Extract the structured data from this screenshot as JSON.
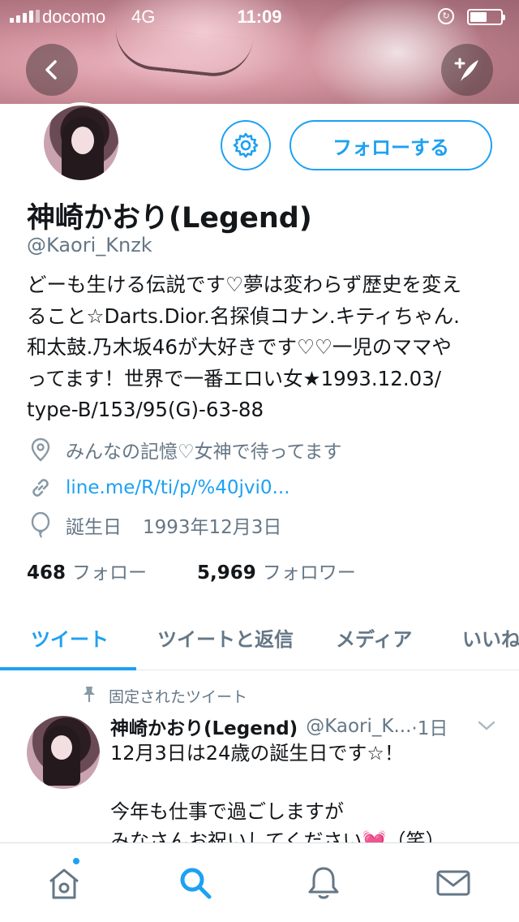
{
  "status_bar": {
    "carrier": "docomo",
    "network": "4G",
    "time": "11:09",
    "battery_level": 0.55
  },
  "header": {
    "back_icon": "chevron-left-icon",
    "compose_icon": "quill-plus-icon"
  },
  "profile": {
    "display_name": "神崎かおり(Legend)",
    "handle": "@Kaori_Knzk",
    "follow_label": "フォローする",
    "settings_icon": "gear-icon",
    "bio_lines": [
      "どーも生ける伝説です♡夢は変わらず歴史を変え",
      "ること☆Darts.Dior.名探偵コナン.キティちゃん.",
      "和太鼓.乃木坂46が大好きです♡♡一児のママや",
      "ってます！世界で一番エロい女★1993.12.03/",
      "type-B/153/95(G)-63-88"
    ],
    "location": "みんなの記憶♡女神で待ってます",
    "link": "line.me/R/ti/p/%40jvi0...",
    "birthday_label": "誕生日",
    "birthday_value": "1993年12月3日",
    "following_count": "468",
    "following_label": "フォロー",
    "followers_count": "5,969",
    "followers_label": "フォロワー"
  },
  "tabs": [
    {
      "label": "ツイート",
      "active": true
    },
    {
      "label": "ツイートと返信",
      "active": false
    },
    {
      "label": "メディア",
      "active": false
    },
    {
      "label": "いいね",
      "active": false
    }
  ],
  "pinned_tweet": {
    "pinned_label": "固定されたツイート",
    "author_name": "神崎かおり(Legend)",
    "author_handle": "@Kaori_K...",
    "separator_time": "·1日",
    "lines": [
      "12月3日は24歳の誕生日です☆！",
      "今年も仕事で過ごしますが",
      "みなさんお祝いしてください💓（笑）"
    ]
  },
  "bottom_nav": [
    {
      "name": "home",
      "icon": "home-icon",
      "active": false,
      "has_badge": true
    },
    {
      "name": "search",
      "icon": "search-icon",
      "active": true
    },
    {
      "name": "notifications",
      "icon": "bell-icon",
      "active": false
    },
    {
      "name": "messages",
      "icon": "envelope-icon",
      "active": false
    }
  ],
  "colors": {
    "accent": "#1da1f2",
    "secondary_text": "#657786",
    "primary_text": "#14171a"
  }
}
